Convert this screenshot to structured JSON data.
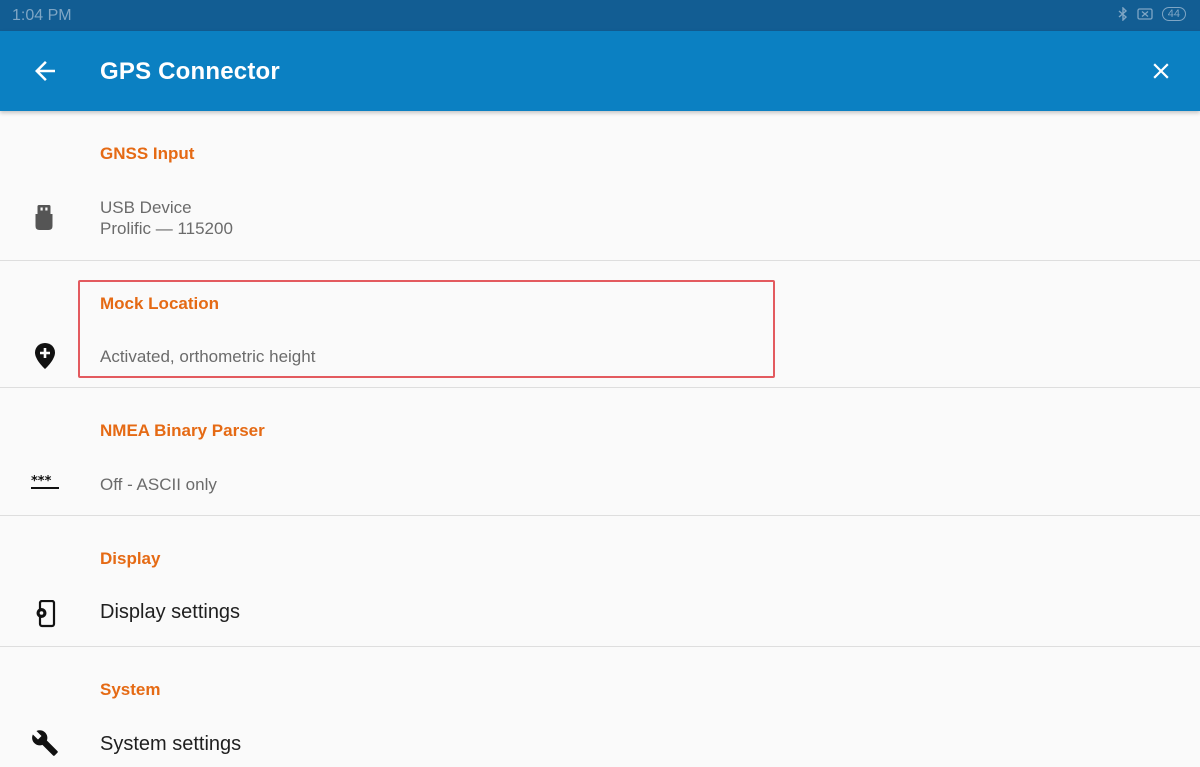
{
  "status_bar": {
    "time": "1:04 PM",
    "battery": "44",
    "icons": [
      "bluetooth-icon",
      "no-sim-icon",
      "battery-icon"
    ]
  },
  "app_bar": {
    "title": "GPS Connector",
    "back_icon": "arrow-back-icon",
    "close_icon": "close-icon",
    "background": "#0b80c2"
  },
  "sections": {
    "gnss": {
      "header": "GNSS Input",
      "line1": "USB Device",
      "line2": "Prolific — 115200",
      "icon": "usb-icon"
    },
    "mock": {
      "header": "Mock Location",
      "line1": "Activated, orthometric height",
      "icon": "add-location-icon"
    },
    "nmea": {
      "header": "NMEA Binary Parser",
      "line1": "Off - ASCII only",
      "icon": "password-dots-icon"
    },
    "display": {
      "header": "Display",
      "line1": "Display settings",
      "icon": "phone-settings-icon"
    },
    "system": {
      "header": "System",
      "line1": "System settings",
      "icon": "wrench-icon"
    }
  },
  "colors": {
    "accent": "#e56a14",
    "highlight": "#e35a5f",
    "status_bar": "#125d93"
  }
}
